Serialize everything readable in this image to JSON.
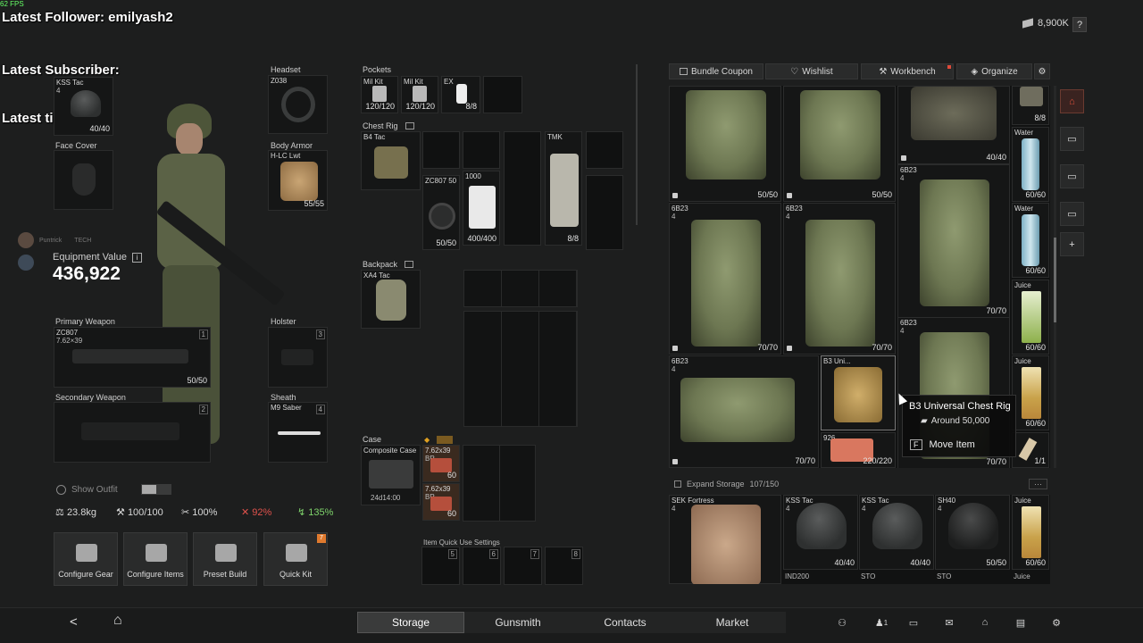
{
  "overlay": {
    "fps": "62 FPS",
    "latest_follower": "Latest Follower: emilyash2",
    "latest_subscriber": "Latest Subscriber:",
    "latest_tipper": "Latest tipper:"
  },
  "top_right": {
    "currency": "8,900K",
    "help": "?"
  },
  "loadout": {
    "headgear_name": "KSS Tac",
    "headgear_count": "4",
    "headgear_dur": "40/40",
    "face_cover_label": "Face Cover",
    "headset_label": "Headset",
    "headset_name": "Z038",
    "body_armor_label": "Body Armor",
    "body_armor_name": "H-LC Lwt",
    "body_armor_dur": "55/55",
    "player_name": "Puntrick",
    "player_tag": "TECH",
    "equipment_value_label": "Equipment Value",
    "equipment_value": "436,922",
    "primary_label": "Primary Weapon",
    "primary_name": "ZC807",
    "primary_cal": "7.62×39",
    "primary_slot": "1",
    "primary_dur": "50/50",
    "secondary_label": "Secondary Weapon",
    "secondary_slot": "2",
    "holster_label": "Holster",
    "holster_slot": "3",
    "sheath_label": "Sheath",
    "sheath_name": "M9 Saber",
    "sheath_slot": "4"
  },
  "stats": {
    "show_outfit": "Show Outfit",
    "weight": "23.8kg",
    "durability": "100/100",
    "stat2": "100%",
    "stat3": "92%",
    "stat4": "135%"
  },
  "quick_buttons": {
    "configure_gear": "Configure Gear",
    "configure_items": "Configure Items",
    "preset_build": "Preset Build",
    "quick_kit": "Quick Kit",
    "quick_kit_badge": "7"
  },
  "gear": {
    "pockets_label": "Pockets",
    "pocket1_name": "Mil Kit",
    "pocket1_count": "120/120",
    "pocket2_name": "Mil Kit",
    "pocket2_count": "120/120",
    "pocket3_name": "EX",
    "pocket3_count": "8/8",
    "chest_rig_label": "Chest Rig",
    "chest_rig_name": "B4 Tac",
    "mag_name": "ZC807 50",
    "mag_count": "50/50",
    "bandage_name": "1000",
    "bandage_count": "400/400",
    "tmk_name": "TMK",
    "tmk_count": "8/8",
    "backpack_label": "Backpack",
    "backpack_name": "XA4 Tac",
    "case_label": "Case",
    "case_name": "Composite Case",
    "case_timer": "24d14:00",
    "ammo1_name": "7.62x39",
    "ammo1_sub": "BP",
    "ammo1_count": "60",
    "ammo2_name": "7.62x39",
    "ammo2_sub": "BP",
    "ammo2_count": "60",
    "quick_use_label": "Item Quick Use Settings",
    "qu_slots": [
      "5",
      "6",
      "7",
      "8"
    ]
  },
  "storage_toolbar": {
    "bundle_coupon": "Bundle Coupon",
    "wishlist": "Wishlist",
    "workbench": "Workbench",
    "organize": "Organize"
  },
  "storage": {
    "vest_a_count": "50/50",
    "vest_b_count": "50/50",
    "vest_c_count": "40/40",
    "small_top_count": "8/8",
    "water1_name": "Water",
    "water1_count": "60/60",
    "water2_name": "Water",
    "water2_count": "60/60",
    "juice1_name": "Juice",
    "juice1_count": "60/60",
    "juice2_name": "Juice",
    "juice2_count": "60/60",
    "vest_6b23_name": "6B23",
    "vest_6b23_level": "4",
    "vest_6b23_count": "70/70",
    "rig_name": "B3 Uni...",
    "med_name": "926",
    "med_count": "220/220",
    "flare_count": "1/1",
    "hidden_count": "70/70"
  },
  "tooltip": {
    "title": "B3 Universal Chest Rig",
    "price": "Around 50,000",
    "key": "F",
    "action": "Move Item"
  },
  "expand": {
    "label": "Expand Storage",
    "capacity": "107/150",
    "menu": "···"
  },
  "bottom_row": {
    "item1_name": "SEK Fortress",
    "item1_level": "4",
    "item2_name": "KSS Tac",
    "item2_level": "4",
    "item2_count": "40/40",
    "item3_name": "KSS Tac",
    "item3_level": "4",
    "item3_count": "40/40",
    "item4_name": "SH40",
    "item4_level": "4",
    "item4_count": "50/50",
    "item5_name": "Juice",
    "item5_count": "60/60",
    "next1": "IND200",
    "next2": "STO",
    "next3": "STO",
    "next4": "Juice"
  },
  "nav": {
    "back": "<",
    "home": "⌂",
    "tabs": [
      "Storage",
      "Gunsmith",
      "Contacts",
      "Market"
    ],
    "squad_count": "1"
  }
}
